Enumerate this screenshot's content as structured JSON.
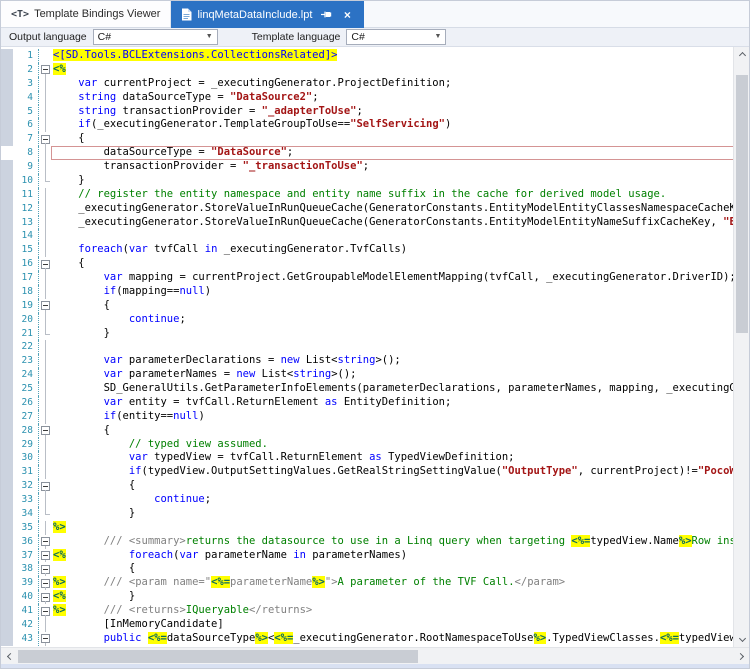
{
  "tabs": {
    "viewer_tab": "Template Bindings Viewer",
    "file_tab": "linqMetaDataInclude.lpt"
  },
  "toolbar": {
    "output_language_label": "Output language",
    "output_language_value": "C#",
    "template_language_label": "Template language",
    "template_language_value": "C#"
  },
  "icons": {
    "template_tab": "<T>",
    "close": "×",
    "dropdown_arrow": "▼",
    "document": "page-with-folded-corner",
    "pin": "sideways-pushpin",
    "scroll_arrows": "chevrons"
  },
  "colors": {
    "active_tab_bg": "#2c72c4",
    "highlight": "#ffff00",
    "keyword": "#0000ff",
    "string": "#a31515",
    "comment": "#008000",
    "xml_doc": "#808080",
    "line_number": "#2b91af",
    "marker_text": "#0b6b5c",
    "current_line_border": "#d49494",
    "gutter_strip": "#ccd3df"
  },
  "editor": {
    "current_line": 8,
    "lines": [
      {
        "n": 1,
        "fold": "",
        "segs": [
          [
            "h",
            "<[SD.Tools.BCLExtensions.CollectionsRelated]>"
          ]
        ]
      },
      {
        "n": 2,
        "fold": "start",
        "segs": [
          [
            "m",
            "<%"
          ]
        ]
      },
      {
        "n": 3,
        "fold": "line",
        "segs": [
          [
            "p",
            "    "
          ],
          [
            "k",
            "var"
          ],
          [
            "p",
            " currentProject = _executingGenerator.ProjectDefinition;"
          ]
        ]
      },
      {
        "n": 4,
        "fold": "line",
        "segs": [
          [
            "p",
            "    "
          ],
          [
            "k",
            "string"
          ],
          [
            "p",
            " dataSourceType = "
          ],
          [
            "s",
            "\"DataSource2\""
          ],
          [
            "p",
            ";"
          ]
        ]
      },
      {
        "n": 5,
        "fold": "line",
        "segs": [
          [
            "p",
            "    "
          ],
          [
            "k",
            "string"
          ],
          [
            "p",
            " transactionProvider = "
          ],
          [
            "s",
            "\"_adapterToUse\""
          ],
          [
            "p",
            ";"
          ]
        ]
      },
      {
        "n": 6,
        "fold": "line",
        "segs": [
          [
            "p",
            "    "
          ],
          [
            "k",
            "if"
          ],
          [
            "p",
            "(_executingGenerator.TemplateGroupToUse=="
          ],
          [
            "s",
            "\"SelfServicing\""
          ],
          [
            "p",
            ")"
          ]
        ]
      },
      {
        "n": 7,
        "fold": "start",
        "segs": [
          [
            "p",
            "    {"
          ]
        ]
      },
      {
        "n": 8,
        "fold": "line",
        "segs": [
          [
            "p",
            "        dataSourceType = "
          ],
          [
            "s",
            "\"DataSource\""
          ],
          [
            "p",
            ";"
          ]
        ]
      },
      {
        "n": 9,
        "fold": "line",
        "segs": [
          [
            "p",
            "        transactionProvider = "
          ],
          [
            "s",
            "\"_transactionToUse\""
          ],
          [
            "p",
            ";"
          ]
        ]
      },
      {
        "n": 10,
        "fold": "end",
        "segs": [
          [
            "p",
            "    }"
          ]
        ]
      },
      {
        "n": 11,
        "fold": "line",
        "segs": [
          [
            "p",
            "    "
          ],
          [
            "c",
            "// register the entity namespace and entity name suffix in the cache for derived model usage."
          ]
        ]
      },
      {
        "n": 12,
        "fold": "line",
        "segs": [
          [
            "p",
            "    _executingGenerator.StoreValueInRunQueueCache(GeneratorConstants.EntityModelEntityClassesNamespaceCacheKey, _exe"
          ]
        ]
      },
      {
        "n": 13,
        "fold": "line",
        "segs": [
          [
            "p",
            "    _executingGenerator.StoreValueInRunQueueCache(GeneratorConstants.EntityModelEntityNameSuffixCacheKey, "
          ],
          [
            "s",
            "\"Entity\""
          ],
          [
            "p",
            ");"
          ]
        ]
      },
      {
        "n": 14,
        "fold": "line",
        "segs": []
      },
      {
        "n": 15,
        "fold": "line",
        "segs": [
          [
            "p",
            "    "
          ],
          [
            "k",
            "foreach"
          ],
          [
            "p",
            "("
          ],
          [
            "k",
            "var"
          ],
          [
            "p",
            " tvfCall "
          ],
          [
            "k",
            "in"
          ],
          [
            "p",
            " _executingGenerator.TvfCalls)"
          ]
        ]
      },
      {
        "n": 16,
        "fold": "start",
        "segs": [
          [
            "p",
            "    {"
          ]
        ]
      },
      {
        "n": 17,
        "fold": "line",
        "segs": [
          [
            "p",
            "        "
          ],
          [
            "k",
            "var"
          ],
          [
            "p",
            " mapping = currentProject.GetGroupableModelElementMapping(tvfCall, _executingGenerator.DriverID);"
          ]
        ]
      },
      {
        "n": 18,
        "fold": "line",
        "segs": [
          [
            "p",
            "        "
          ],
          [
            "k",
            "if"
          ],
          [
            "p",
            "(mapping=="
          ],
          [
            "k",
            "null"
          ],
          [
            "p",
            ")"
          ]
        ]
      },
      {
        "n": 19,
        "fold": "start",
        "segs": [
          [
            "p",
            "        {"
          ]
        ]
      },
      {
        "n": 20,
        "fold": "line",
        "segs": [
          [
            "p",
            "            "
          ],
          [
            "k",
            "continue"
          ],
          [
            "p",
            ";"
          ]
        ]
      },
      {
        "n": 21,
        "fold": "end",
        "segs": [
          [
            "p",
            "        }"
          ]
        ]
      },
      {
        "n": 22,
        "fold": "line",
        "segs": []
      },
      {
        "n": 23,
        "fold": "line",
        "segs": [
          [
            "p",
            "        "
          ],
          [
            "k",
            "var"
          ],
          [
            "p",
            " parameterDeclarations = "
          ],
          [
            "k",
            "new"
          ],
          [
            "p",
            " List<"
          ],
          [
            "k",
            "string"
          ],
          [
            "p",
            ">();"
          ]
        ]
      },
      {
        "n": 24,
        "fold": "line",
        "segs": [
          [
            "p",
            "        "
          ],
          [
            "k",
            "var"
          ],
          [
            "p",
            " parameterNames = "
          ],
          [
            "k",
            "new"
          ],
          [
            "p",
            " List<"
          ],
          [
            "k",
            "string"
          ],
          [
            "p",
            ">();"
          ]
        ]
      },
      {
        "n": 25,
        "fold": "line",
        "segs": [
          [
            "p",
            "        SD_GeneralUtils.GetParameterInfoElements(parameterDeclarations, parameterNames, mapping, _executingGenerator"
          ]
        ]
      },
      {
        "n": 26,
        "fold": "line",
        "segs": [
          [
            "p",
            "        "
          ],
          [
            "k",
            "var"
          ],
          [
            "p",
            " entity = tvfCall.ReturnElement "
          ],
          [
            "k",
            "as"
          ],
          [
            "p",
            " EntityDefinition;"
          ]
        ]
      },
      {
        "n": 27,
        "fold": "line",
        "segs": [
          [
            "p",
            "        "
          ],
          [
            "k",
            "if"
          ],
          [
            "p",
            "(entity=="
          ],
          [
            "k",
            "null"
          ],
          [
            "p",
            ")"
          ]
        ]
      },
      {
        "n": 28,
        "fold": "start",
        "segs": [
          [
            "p",
            "        {"
          ]
        ]
      },
      {
        "n": 29,
        "fold": "line",
        "segs": [
          [
            "p",
            "            "
          ],
          [
            "c",
            "// typed view assumed."
          ]
        ]
      },
      {
        "n": 30,
        "fold": "line",
        "segs": [
          [
            "p",
            "            "
          ],
          [
            "k",
            "var"
          ],
          [
            "p",
            " typedView = tvfCall.ReturnElement "
          ],
          [
            "k",
            "as"
          ],
          [
            "p",
            " TypedViewDefinition;"
          ]
        ]
      },
      {
        "n": 31,
        "fold": "line",
        "segs": [
          [
            "p",
            "            "
          ],
          [
            "k",
            "if"
          ],
          [
            "p",
            "(typedView.OutputSettingValues.GetRealStringSettingValue("
          ],
          [
            "s",
            "\"OutputType\""
          ],
          [
            "p",
            ", currentProject)!="
          ],
          [
            "s",
            "\"PocoWithL"
          ]
        ]
      },
      {
        "n": 32,
        "fold": "start",
        "segs": [
          [
            "p",
            "            {"
          ]
        ]
      },
      {
        "n": 33,
        "fold": "line",
        "segs": [
          [
            "p",
            "                "
          ],
          [
            "k",
            "continue"
          ],
          [
            "p",
            ";"
          ]
        ]
      },
      {
        "n": 34,
        "fold": "end",
        "segs": [
          [
            "p",
            "            }"
          ]
        ]
      },
      {
        "n": 35,
        "fold": "line",
        "segs": [
          [
            "m",
            "%>"
          ]
        ]
      },
      {
        "n": 36,
        "fold": "start",
        "segs": [
          [
            "p",
            "        "
          ],
          [
            "g",
            "/// <summary>"
          ],
          [
            "c",
            "returns the datasource to use in a Linq query when targeting "
          ],
          [
            "m",
            "<%="
          ],
          [
            "p",
            "typedView.Name"
          ],
          [
            "m",
            "%>"
          ],
          [
            "c",
            "Row instances r"
          ]
        ]
      },
      {
        "n": 37,
        "fold": "start",
        "segs": [
          [
            "m",
            "<%"
          ],
          [
            "p",
            "          "
          ],
          [
            "k",
            "foreach"
          ],
          [
            "p",
            "("
          ],
          [
            "k",
            "var"
          ],
          [
            "p",
            " parameterName "
          ],
          [
            "k",
            "in"
          ],
          [
            "p",
            " parameterNames)"
          ]
        ]
      },
      {
        "n": 38,
        "fold": "start",
        "segs": [
          [
            "p",
            "            {"
          ]
        ]
      },
      {
        "n": 39,
        "fold": "start",
        "segs": [
          [
            "m",
            "%>"
          ],
          [
            "p",
            "      "
          ],
          [
            "g",
            "/// <param name=\""
          ],
          [
            "m",
            "<%="
          ],
          [
            "g",
            "parameterName"
          ],
          [
            "m",
            "%>"
          ],
          [
            "g",
            "\">"
          ],
          [
            "c",
            "A parameter of the TVF Call."
          ],
          [
            "g",
            "</param>"
          ]
        ]
      },
      {
        "n": 40,
        "fold": "start",
        "segs": [
          [
            "m",
            "<%"
          ],
          [
            "p",
            "          }"
          ]
        ]
      },
      {
        "n": 41,
        "fold": "start",
        "segs": [
          [
            "m",
            "%>"
          ],
          [
            "p",
            "      "
          ],
          [
            "g",
            "/// <returns>"
          ],
          [
            "c",
            "IQueryable"
          ],
          [
            "g",
            "</returns>"
          ]
        ]
      },
      {
        "n": 42,
        "fold": "line",
        "segs": [
          [
            "p",
            "        [InMemoryCandidate]"
          ]
        ]
      },
      {
        "n": 43,
        "fold": "start",
        "segs": [
          [
            "p",
            "        "
          ],
          [
            "k",
            "public"
          ],
          [
            "p",
            " "
          ],
          [
            "m",
            "<%="
          ],
          [
            "p",
            "dataSourceType"
          ],
          [
            "m",
            "%>"
          ],
          [
            "p",
            "<"
          ],
          [
            "m",
            "<%="
          ],
          [
            "p",
            "_executingGenerator.RootNamespaceToUse"
          ],
          [
            "m",
            "%>"
          ],
          [
            "p",
            ".TypedViewClasses."
          ],
          [
            "m",
            "<%="
          ],
          [
            "p",
            "typedView.Name"
          ],
          [
            "m",
            "%"
          ]
        ]
      }
    ]
  }
}
